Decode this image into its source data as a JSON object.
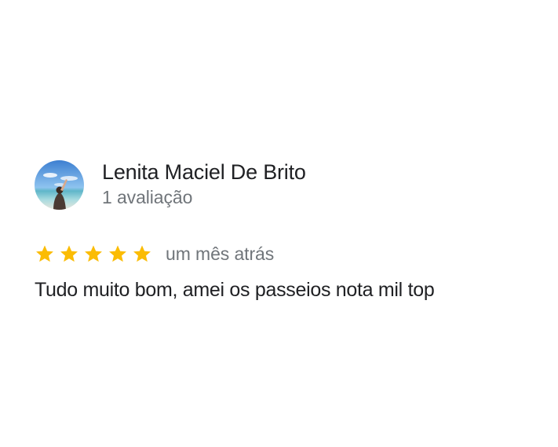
{
  "review": {
    "author_name": "Lenita Maciel De Brito",
    "review_count": "1 avaliação",
    "rating": 5,
    "max_rating": 5,
    "date": "um mês atrás",
    "text": "Tudo muito bom, amei os passeios nota mil top"
  },
  "colors": {
    "star": "#fbbc04",
    "primary_text": "#202124",
    "secondary_text": "#70757a"
  },
  "icons": {
    "avatar": "profile-photo-beach",
    "star": "star-icon"
  }
}
